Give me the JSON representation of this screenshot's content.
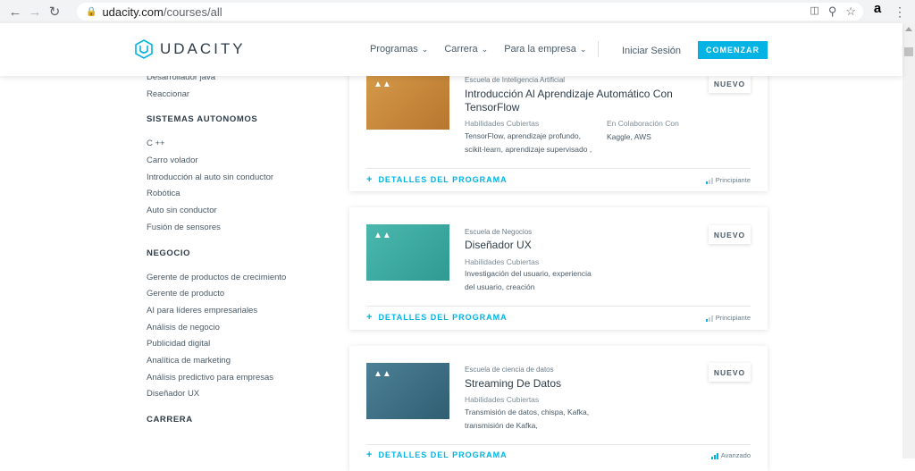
{
  "browser": {
    "url_host": "udacity.com",
    "url_path": "/courses/all",
    "extension_label": "a"
  },
  "header": {
    "logo_text": "UDACITY",
    "nav": [
      {
        "label": "Programas"
      },
      {
        "label": "Carrera"
      },
      {
        "label": "Para la empresa"
      }
    ],
    "login_label": "Iniciar Sesión",
    "cta_label": "COMENZAR"
  },
  "colors": {
    "accent": "#02b3e4",
    "text_dark": "#2e3d49",
    "thumb_ai": "#c98a3b",
    "thumb_business": "#3aa9a0",
    "thumb_data": "#3d6f84"
  },
  "sidebar": {
    "top_links": [
      "Desarrollador java",
      "Reaccionar"
    ],
    "sections": [
      {
        "heading": "SISTEMAS AUTONOMOS",
        "links": [
          "C ++",
          "Carro volador",
          "Introducción al auto sin conductor",
          "Robótica",
          "Auto sin conductor",
          "Fusión de sensores"
        ]
      },
      {
        "heading": "NEGOCIO",
        "links": [
          "Gerente de productos de crecimiento",
          "Gerente de producto",
          "AI para líderes empresariales",
          "Análisis de negocio",
          "Publicidad digital",
          "Analítica de marketing",
          "Análisis predictivo para empresas",
          "Diseñador UX"
        ]
      },
      {
        "heading": "CARRERA",
        "links": []
      }
    ]
  },
  "cards": [
    {
      "school": "Escuela de Inteligencia Artificial",
      "title": "Introducción Al Aprendizaje Automático Con TensorFlow",
      "skills_heading": "Habilidades Cubiertas",
      "skills": "TensorFlow, aprendizaje profundo, scikit-learn, aprendizaje supervisado ,",
      "collab_heading": "En Colaboración Con",
      "collab": "Kaggle, AWS",
      "badge": "NUEVO",
      "details_label": "DETALLES DEL PROGRAMA",
      "level": "Principiante",
      "level_value": 1
    },
    {
      "school": "Escuela de Negocios",
      "title": "Diseñador UX",
      "skills_heading": "Habilidades Cubiertas",
      "skills": "Investigación del usuario, experiencia del usuario, creación",
      "badge": "NUEVO",
      "details_label": "DETALLES DEL PROGRAMA",
      "level": "Principiante",
      "level_value": 1
    },
    {
      "school": "Escuela de ciencia de datos",
      "title": "Streaming De Datos",
      "skills_heading": "Habilidades Cubiertas",
      "skills": "Transmisión de datos, chispa, Kafka, transmisión de Kafka,",
      "badge": "NUEVO",
      "details_label": "DETALLES DEL PROGRAMA",
      "level": "Avanzado",
      "level_value": 3
    }
  ]
}
